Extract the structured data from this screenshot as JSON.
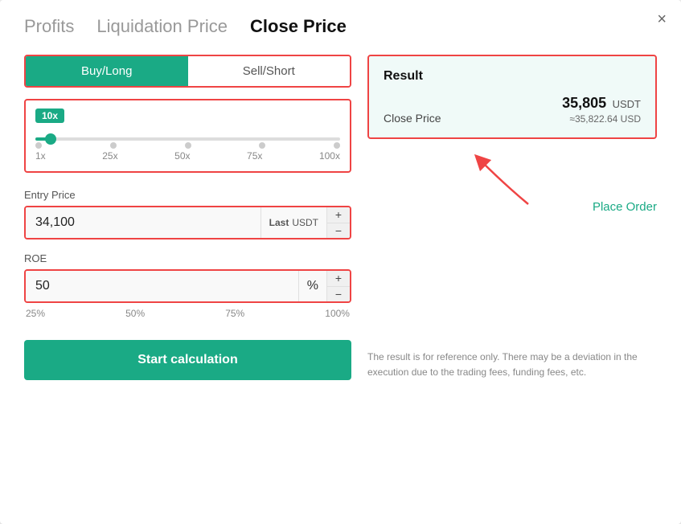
{
  "modal": {
    "close_label": "×"
  },
  "tabs": [
    {
      "id": "profits",
      "label": "Profits",
      "active": false
    },
    {
      "id": "liquidation-price",
      "label": "Liquidation Price",
      "active": false
    },
    {
      "id": "close-price",
      "label": "Close Price",
      "active": true
    }
  ],
  "direction": {
    "buy_label": "Buy/Long",
    "sell_label": "Sell/Short"
  },
  "leverage": {
    "badge": "10x",
    "labels": [
      "1x",
      "25x",
      "50x",
      "75x",
      "100x"
    ]
  },
  "entry_price": {
    "label": "Entry Price",
    "value": "34,100",
    "suffix_highlight": "Last",
    "suffix": "USDT"
  },
  "roe": {
    "label": "ROE",
    "value": "50",
    "suffix": "%",
    "quick_values": [
      "25%",
      "50%",
      "75%",
      "100%"
    ]
  },
  "calc_button": {
    "label": "Start calculation"
  },
  "result": {
    "title": "Result",
    "key": "Close Price",
    "value": "35,805",
    "unit": "USDT",
    "approx": "≈35,822.64 USD"
  },
  "place_order": {
    "label": "Place Order"
  },
  "disclaimer": {
    "text": "The result is for reference only. There may be a deviation in the execution due to the trading fees, funding fees, etc."
  }
}
